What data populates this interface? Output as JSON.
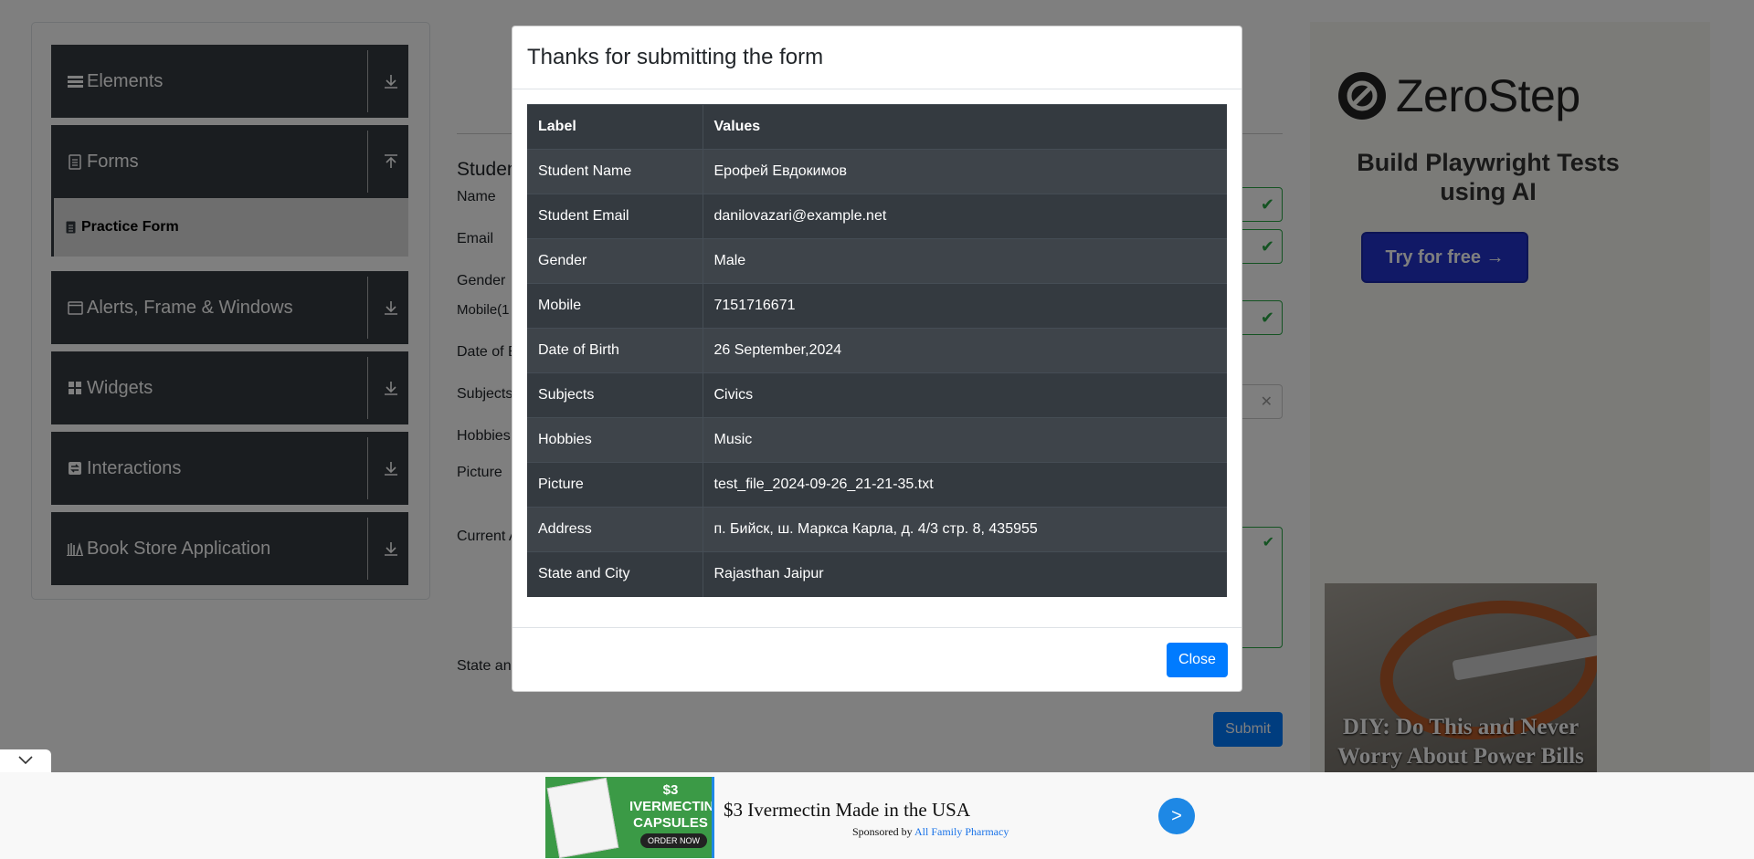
{
  "sidebar": {
    "groups": [
      {
        "label": "Elements",
        "icon": "menu-icon",
        "arrow": "download-arrow-icon"
      },
      {
        "label": "Forms",
        "icon": "document-icon",
        "arrow": "upload-arrow-icon"
      },
      {
        "label": "Alerts, Frame & Windows",
        "icon": "window-icon",
        "arrow": "download-arrow-icon"
      },
      {
        "label": "Widgets",
        "icon": "widgets-icon",
        "arrow": "download-arrow-icon"
      },
      {
        "label": "Interactions",
        "icon": "interactions-icon",
        "arrow": "download-arrow-icon"
      },
      {
        "label": "Book Store Application",
        "icon": "books-icon",
        "arrow": "download-arrow-icon"
      }
    ],
    "active_item": "Practice Form"
  },
  "form": {
    "heading": "Studen",
    "labels": {
      "name": "Name",
      "email": "Email",
      "gender": "Gender",
      "mobile": "Mobile(1",
      "dob": "Date of B",
      "subjects": "Subjects",
      "hobbies": "Hobbies",
      "picture": "Picture",
      "current_address": "Current A",
      "state": "State an"
    },
    "submit_label": "Submit"
  },
  "modal": {
    "title": "Thanks for submitting the form",
    "headers": {
      "label": "Label",
      "values": "Values"
    },
    "rows": [
      {
        "label": "Student Name",
        "value": "Ерофей Евдокимов"
      },
      {
        "label": "Student Email",
        "value": "danilovazari@example.net"
      },
      {
        "label": "Gender",
        "value": "Male"
      },
      {
        "label": "Mobile",
        "value": "7151716671"
      },
      {
        "label": "Date of Birth",
        "value": "26 September,2024"
      },
      {
        "label": "Subjects",
        "value": "Civics"
      },
      {
        "label": "Hobbies",
        "value": "Music"
      },
      {
        "label": "Picture",
        "value": "test_file_2024-09-26_21-21-35.txt"
      },
      {
        "label": "Address",
        "value": "п. Бийск, ш. Маркса Карла, д. 4/3 стр. 8, 435955"
      },
      {
        "label": "State and City",
        "value": "Rajasthan Jaipur"
      }
    ],
    "close_label": "Close"
  },
  "right_ad": {
    "brand": "ZeroStep",
    "tagline": "Build Playwright Tests using AI",
    "cta": "Try for free →",
    "secondary_headline": "DIY: Do This and Never Worry About Power Bills"
  },
  "bottom_ad": {
    "image_text_price": "$3",
    "image_text_product": "IVERMECTIN CAPSULES",
    "image_text_order": "ORDER NOW",
    "headline": "$3 Ivermectin Made in the USA",
    "sponsored_prefix": "Sponsored by",
    "sponsor_name": "All Family Pharmacy",
    "go_symbol": ">"
  },
  "colors": {
    "sidebar_group_bg": "#343a40",
    "primary_button": "#007bff",
    "valid_green": "#28a745",
    "zerostep_blue": "#2233cc"
  }
}
